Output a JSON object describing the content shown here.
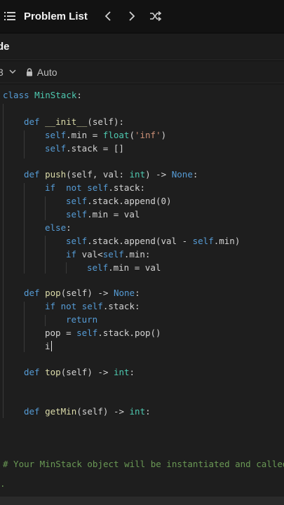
{
  "header": {
    "title": "Problem List",
    "icons": [
      "list-icon",
      "chevron-left-icon",
      "chevron-right-icon",
      "shuffle-icon"
    ]
  },
  "tab": {
    "label": "de"
  },
  "toolbar": {
    "language": "3",
    "mode": "Auto",
    "icons": [
      "chevron-down-icon",
      "lock-icon"
    ]
  },
  "editor": {
    "lines": {
      "l1a": "class",
      "l1b": "MinStack",
      "l1c": ":",
      "l2a": "def",
      "l2b": "__init__",
      "l2c": "(self):",
      "l3a": "self",
      "l3b": ".min = ",
      "l3c": "float",
      "l3d": "(",
      "l3e": "'inf'",
      "l3f": ")",
      "l4a": "self",
      "l4b": ".stack = []",
      "l5a": "def",
      "l5b": "push",
      "l5c": "(self, val: ",
      "l5d": "int",
      "l5e": ") -> ",
      "l5f": "None",
      "l5g": ":",
      "l6a": "if",
      "l6b": "  not ",
      "l6c": "self",
      "l6d": ".stack:",
      "l7a": "self",
      "l7b": ".stack.append(0)",
      "l8a": "self",
      "l8b": ".min = val",
      "l9a": "else",
      "l9b": ":",
      "l10a": "self",
      "l10b": ".stack.append(val - ",
      "l10c": "self",
      "l10d": ".min)",
      "l11a": "if",
      "l11b": " val<",
      "l11c": "self",
      "l11d": ".min:",
      "l12a": "self",
      "l12b": ".min = val",
      "l13a": "def",
      "l13b": "pop",
      "l13c": "(self) -> ",
      "l13d": "None",
      "l13e": ":",
      "l14a": "if",
      "l14b": " not ",
      "l14c": "self",
      "l14d": ".stack:",
      "l15a": "return",
      "l16a": "pop = ",
      "l16b": "self",
      "l16c": ".stack.pop()",
      "l17a": "i",
      "l18a": "def",
      "l18b": "top",
      "l18c": "(self) -> ",
      "l18d": "int",
      "l18e": ":",
      "l19a": "def",
      "l19b": "getMin",
      "l19c": "(self) -> ",
      "l19d": "int",
      "l19e": ":",
      "l20a": "# Your MinStack object will be instantiated and called as such:",
      "l21a": "."
    }
  }
}
